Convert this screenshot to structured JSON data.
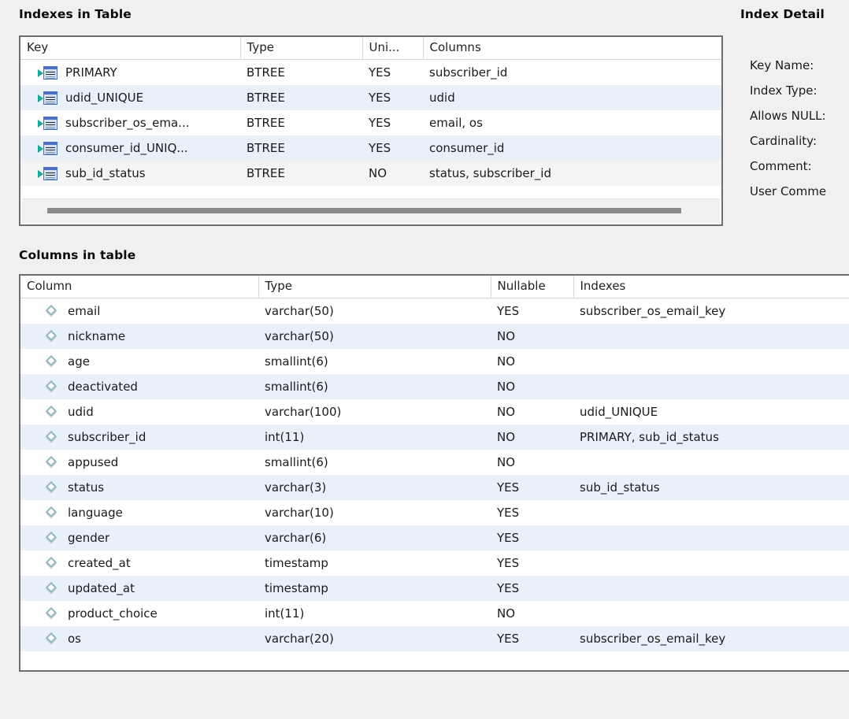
{
  "sections": {
    "indexes_title": "Indexes in Table",
    "columns_title": "Columns in table",
    "detail_title": "Index Detail"
  },
  "indexes_grid": {
    "headers": {
      "key": "Key",
      "type": "Type",
      "unique": "Uni...",
      "columns": "Columns"
    },
    "rows": [
      {
        "icon": "index-icon",
        "key": "PRIMARY",
        "type": "BTREE",
        "unique": "YES",
        "columns": "subscriber_id"
      },
      {
        "icon": "index-icon",
        "key": "udid_UNIQUE",
        "type": "BTREE",
        "unique": "YES",
        "columns": "udid"
      },
      {
        "icon": "index-icon",
        "key": "subscriber_os_ema...",
        "type": "BTREE",
        "unique": "YES",
        "columns": "email, os"
      },
      {
        "icon": "index-icon",
        "key": "consumer_id_UNIQ...",
        "type": "BTREE",
        "unique": "YES",
        "columns": "consumer_id"
      },
      {
        "icon": "index-icon",
        "key": "sub_id_status",
        "type": "BTREE",
        "unique": "NO",
        "columns": "status, subscriber_id"
      }
    ],
    "selected_row_index": 4,
    "scrollbar": "horizontal-scrollbar"
  },
  "columns_grid": {
    "headers": {
      "column": "Column",
      "type": "Type",
      "nullable": "Nullable",
      "indexes": "Indexes"
    },
    "rows": [
      {
        "icon": "diamond-icon",
        "column": "email",
        "type": "varchar(50)",
        "nullable": "YES",
        "indexes": "subscriber_os_email_key"
      },
      {
        "icon": "diamond-icon",
        "column": "nickname",
        "type": "varchar(50)",
        "nullable": "NO",
        "indexes": ""
      },
      {
        "icon": "diamond-icon",
        "column": "age",
        "type": "smallint(6)",
        "nullable": "NO",
        "indexes": ""
      },
      {
        "icon": "diamond-icon",
        "column": "deactivated",
        "type": "smallint(6)",
        "nullable": "NO",
        "indexes": ""
      },
      {
        "icon": "diamond-icon",
        "column": "udid",
        "type": "varchar(100)",
        "nullable": "NO",
        "indexes": "udid_UNIQUE"
      },
      {
        "icon": "diamond-icon",
        "column": "subscriber_id",
        "type": "int(11)",
        "nullable": "NO",
        "indexes": "PRIMARY, sub_id_status"
      },
      {
        "icon": "diamond-icon",
        "column": "appused",
        "type": "smallint(6)",
        "nullable": "NO",
        "indexes": ""
      },
      {
        "icon": "diamond-icon",
        "column": "status",
        "type": "varchar(3)",
        "nullable": "YES",
        "indexes": "sub_id_status"
      },
      {
        "icon": "diamond-icon",
        "column": "language",
        "type": "varchar(10)",
        "nullable": "YES",
        "indexes": ""
      },
      {
        "icon": "diamond-icon",
        "column": "gender",
        "type": "varchar(6)",
        "nullable": "YES",
        "indexes": ""
      },
      {
        "icon": "diamond-icon",
        "column": "created_at",
        "type": "timestamp",
        "nullable": "YES",
        "indexes": ""
      },
      {
        "icon": "diamond-icon",
        "column": "updated_at",
        "type": "timestamp",
        "nullable": "YES",
        "indexes": ""
      },
      {
        "icon": "diamond-icon",
        "column": "product_choice",
        "type": "int(11)",
        "nullable": "NO",
        "indexes": ""
      },
      {
        "icon": "diamond-icon",
        "column": "os",
        "type": "varchar(20)",
        "nullable": "YES",
        "indexes": "subscriber_os_email_key"
      }
    ],
    "clipped_row": {
      "column": "",
      "type": "",
      "nullable": "",
      "indexes": ""
    }
  },
  "index_detail": {
    "labels": [
      "Key Name:",
      "Index Type:",
      "Allows NULL:",
      "Cardinality:",
      "Comment:",
      "User Comme"
    ]
  },
  "colors": {
    "row_stripe": "#eaf0fa",
    "panel_border": "#6e6e6e",
    "page_background": "#f0f0f0",
    "index_icon_arrow": "#16a898",
    "index_icon_table": "#4a6fc4",
    "diamond_icon": "#8fb8bd",
    "scrollbar_thumb": "#8a8a8a"
  }
}
